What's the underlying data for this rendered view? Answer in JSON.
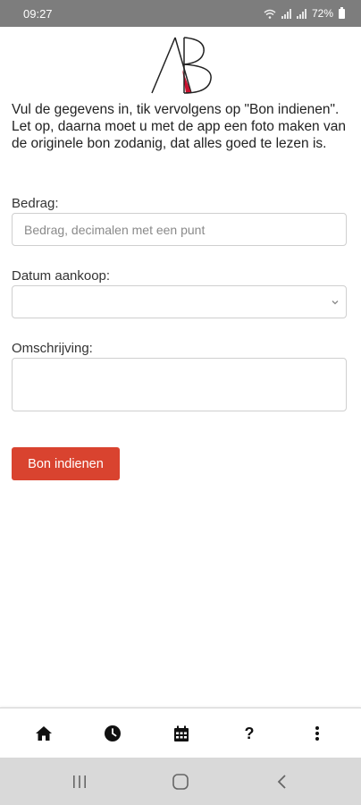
{
  "status_bar": {
    "time": "09:27",
    "battery": "72%"
  },
  "intro_text": "Vul de gegevens in, tik vervolgens op \"Bon indienen\". Let op, daarna moet u met de app een foto maken van de originele bon zodanig, dat alles goed te lezen is.",
  "form": {
    "amount": {
      "label": "Bedrag:",
      "placeholder": "Bedrag, decimalen met een punt",
      "value": ""
    },
    "date": {
      "label": "Datum aankoop:",
      "value": ""
    },
    "description": {
      "label": "Omschrijving:",
      "value": ""
    },
    "submit_label": "Bon indienen"
  },
  "colors": {
    "accent": "#d9432f",
    "status_bar": "#7d7d7d",
    "system_nav": "#d9d9d9"
  },
  "bottom_nav": [
    "home-icon",
    "clock-icon",
    "calendar-icon",
    "help-icon",
    "more-vertical-icon"
  ],
  "bottom_nav_help_glyph": "?"
}
